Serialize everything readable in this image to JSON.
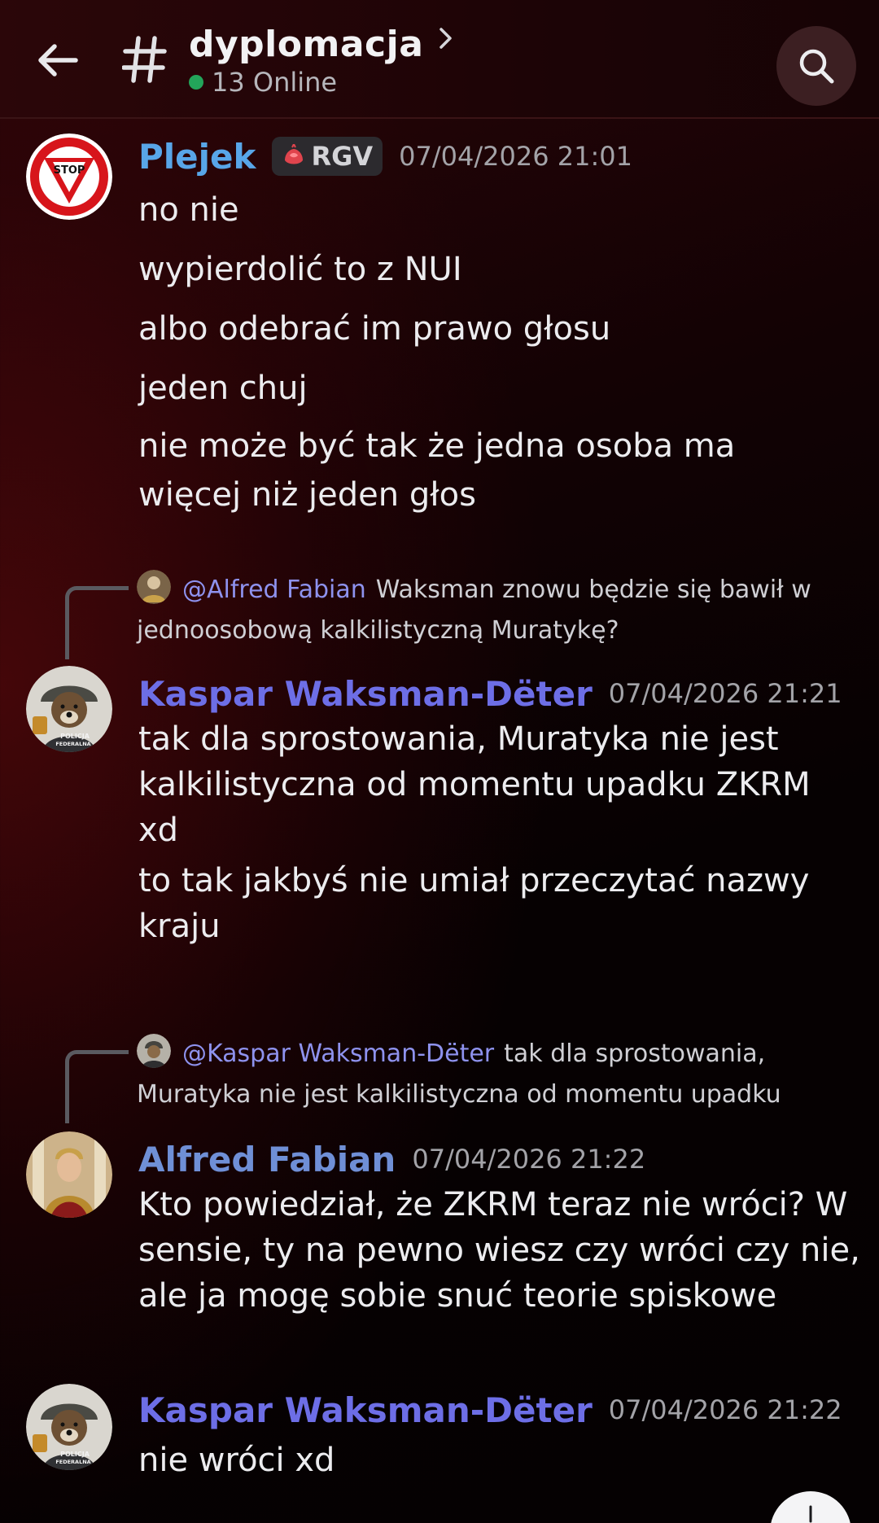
{
  "header": {
    "channel_name": "dyplomacja",
    "online_count": "13 Online"
  },
  "messages": [
    {
      "author": "Plejek",
      "role": "RGV",
      "timestamp": "07/04/2026 21:01",
      "lines": [
        "no nie",
        "wypierdolić to z NUI",
        "albo odebrać im prawo głosu",
        "jeden chuj",
        "nie może być tak że jedna osoba ma więcej niż jeden głos"
      ]
    },
    {
      "reply": {
        "mention": "@Alfred Fabian",
        "text": "Waksman znowu będzie się bawił w jednoosobową kalkilistyczną Muratykę?"
      },
      "author": "Kaspar Waksman-Dëter",
      "timestamp": "07/04/2026 21:21",
      "lines": [
        "tak dla sprostowania, Muratyka nie jest kalkilistyczna od momentu upadku ZKRM xd",
        "to tak jakbyś nie umiał przeczytać nazwy kraju"
      ]
    },
    {
      "reply": {
        "mention": "@Kaspar Waksman-Dëter",
        "text": "tak dla sprostowania, Muratyka nie jest kalkilistyczna od momentu upadku"
      },
      "author": "Alfred Fabian",
      "timestamp": "07/04/2026 21:22",
      "lines": [
        "Kto powiedział, że ZKRM teraz nie wróci? W sensie, ty na pewno wiesz czy wróci czy nie, ale ja mogę sobie snuć teorie spiskowe"
      ]
    },
    {
      "author": "Kaspar Waksman-Dëter",
      "timestamp": "07/04/2026 21:22",
      "lines": [
        "nie wróci xd"
      ]
    }
  ],
  "avatar_badge_text": "STOP",
  "avatar_police_text": "POLICJA FEDERALNA",
  "colors": {
    "online": "#23a55a",
    "author_plejek": "#58a6e8",
    "author_kaspar": "#6d6ee6",
    "author_alfred": "#6f8fd6",
    "mention": "#8e92ee"
  }
}
